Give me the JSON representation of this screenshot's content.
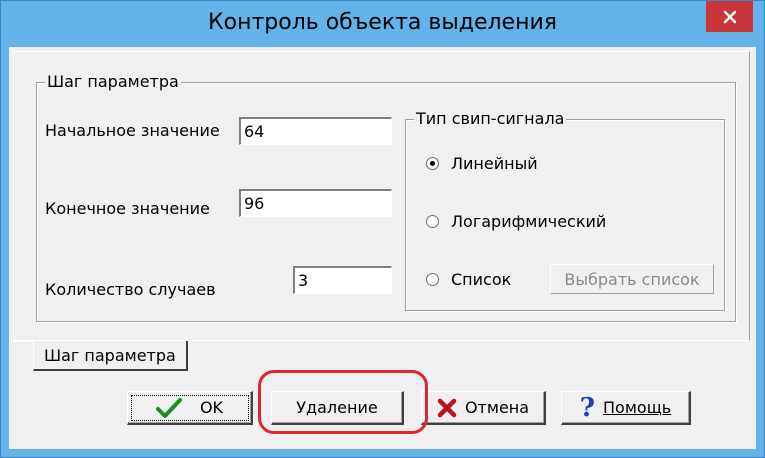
{
  "window": {
    "title": "Контроль объекта выделения",
    "close_label": "×"
  },
  "step_group": {
    "caption": "Шаг параметра",
    "start_label": "Начальное значение",
    "start_value": "64",
    "end_label": "Конечное значение",
    "end_value": "96",
    "count_label": "Количество случаев",
    "count_value": "3"
  },
  "sweep_group": {
    "caption": "Тип свип-сигнала",
    "options": [
      {
        "label": "Линейный",
        "selected": true
      },
      {
        "label": "Логарифмический",
        "selected": false
      },
      {
        "label": "Список",
        "selected": false
      }
    ],
    "choose_list_label": "Выбрать список"
  },
  "tabs": [
    {
      "label": "Шаг параметра",
      "active": true
    }
  ],
  "buttons": {
    "ok_label": "OK",
    "delete_label": "Удаление",
    "cancel_label": "Отмена",
    "help_label": "Помощь"
  },
  "icons": {
    "ok": "checkmark-icon",
    "cancel": "red-x-icon",
    "help": "question-mark-icon"
  },
  "colors": {
    "frame": "#64b2ea",
    "close": "#c8363a",
    "highlight": "#e0262e",
    "ok_icon": "#1e8c1e",
    "help_icon": "#1f3fb0"
  }
}
